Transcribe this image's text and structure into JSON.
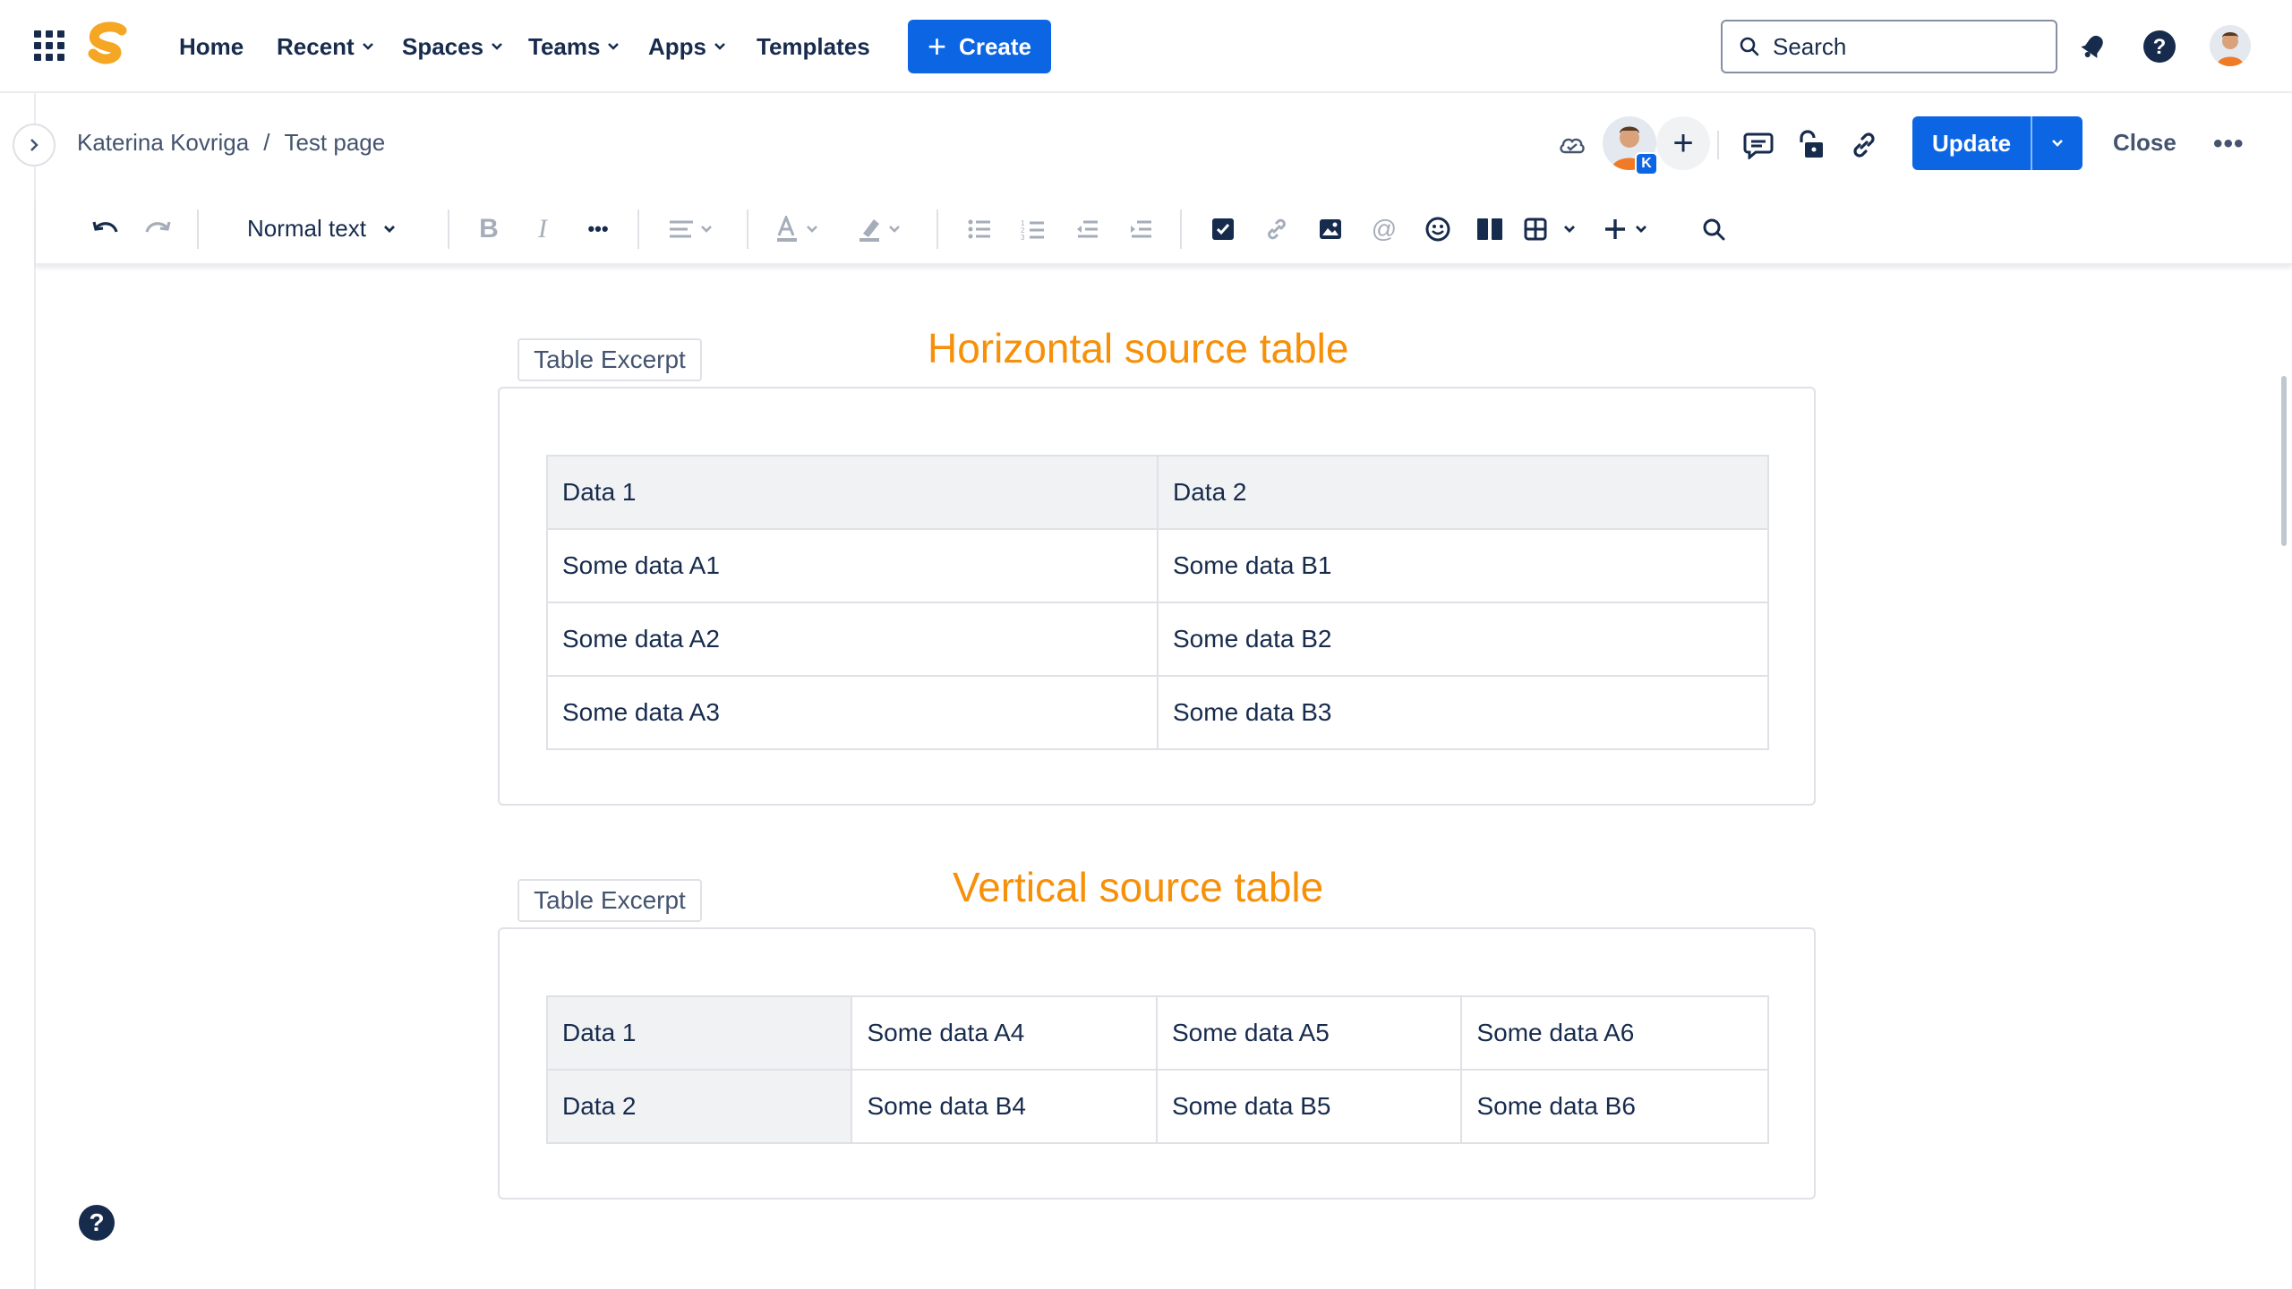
{
  "nav": {
    "items": [
      {
        "label": "Home"
      },
      {
        "label": "Recent"
      },
      {
        "label": "Spaces"
      },
      {
        "label": "Teams"
      },
      {
        "label": "Apps"
      },
      {
        "label": "Templates"
      }
    ],
    "create_label": "Create",
    "search_placeholder": "Search"
  },
  "breadcrumb": {
    "space": "Katerina Kovriga",
    "separator": "/",
    "page": "Test page"
  },
  "header": {
    "collaborator_initial": "K",
    "update_label": "Update",
    "close_label": "Close",
    "more_label": "•••"
  },
  "toolbar": {
    "text_style": "Normal text"
  },
  "content": {
    "horizontal": {
      "excerpt_label": "Table Excerpt",
      "title": "Horizontal source table",
      "rows": [
        [
          "Data 1",
          "Data 2"
        ],
        [
          "Some data A1",
          "Some data B1"
        ],
        [
          "Some data A2",
          "Some data B2"
        ],
        [
          "Some data A3",
          "Some data B3"
        ]
      ]
    },
    "vertical": {
      "excerpt_label": "Table Excerpt",
      "title": "Vertical source table",
      "rows": [
        [
          "Data 1",
          "Some data A4",
          "Some data A5",
          "Some data A6"
        ],
        [
          "Data 2",
          "Some data B4",
          "Some data B5",
          "Some data B6"
        ]
      ]
    }
  },
  "colors": {
    "accent": "#0c66e4",
    "title_orange": "#f79009",
    "logo_orange": "#f5a623"
  }
}
